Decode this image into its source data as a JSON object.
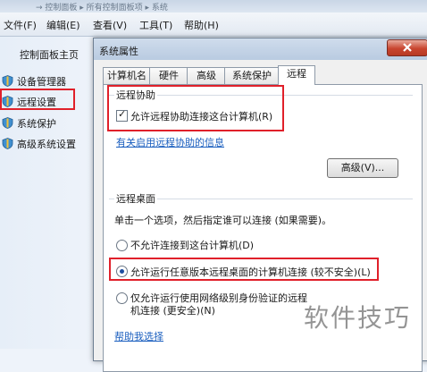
{
  "top_strip": {
    "path": "→ 控制面板 ▸ 所有控制面板项 ▸ 系统"
  },
  "menubar": {
    "items": [
      "文件(F)",
      "编辑(E)",
      "查看(V)",
      "工具(T)",
      "帮助(H)"
    ]
  },
  "left_pane": {
    "home": "控制面板主页",
    "items": [
      "设备管理器",
      "远程设置",
      "系统保护",
      "高级系统设置"
    ]
  },
  "dialog": {
    "title": "系统属性",
    "tabs": [
      "计算机名",
      "硬件",
      "高级",
      "系统保护",
      "远程"
    ],
    "active_tab": "远程",
    "remote_assistance": {
      "label": "远程协助",
      "allow_checkbox": "允许远程协助连接这台计算机(R)",
      "allow_checked": true,
      "info_link": "有关启用远程协助的信息",
      "advanced_button": "高级(V)..."
    },
    "remote_desktop": {
      "label": "远程桌面",
      "instruction": "单击一个选项，然后指定谁可以连接 (如果需要)。",
      "options": [
        "不允许连接到这台计算机(D)",
        "允许运行任意版本远程桌面的计算机连接 (较不安全)(L)",
        "仅允许运行使用网络级别身份验证的远程",
        "机连接 (更安全)(N)"
      ],
      "selected_option": 1,
      "help_link": "帮助我选择"
    }
  },
  "watermark": "软件技巧",
  "colors": {
    "highlight_box": "#e0202a",
    "link": "#1b5fbf",
    "close_button": "#c8452f"
  }
}
